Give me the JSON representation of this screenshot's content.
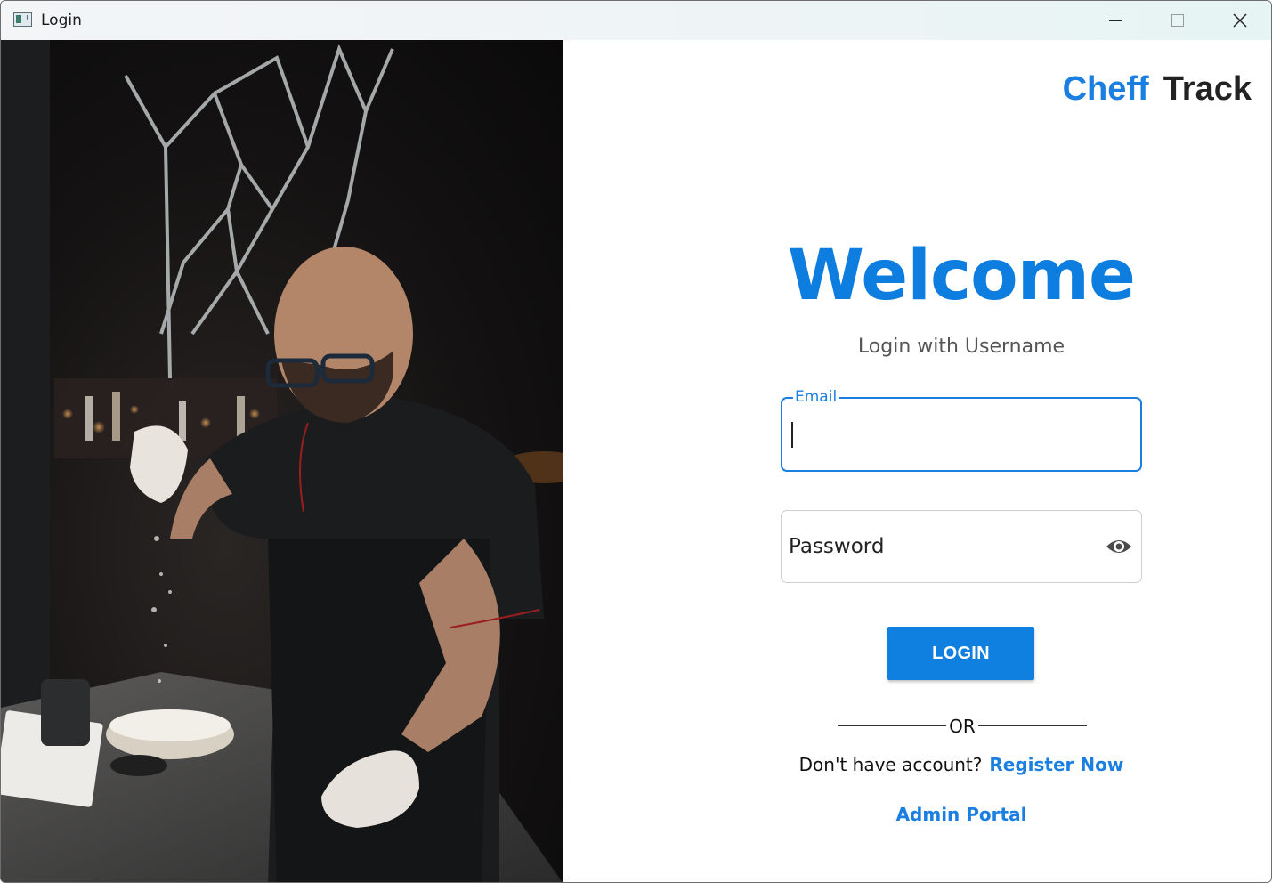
{
  "window": {
    "title": "Login",
    "controls": [
      "minimize",
      "maximize",
      "close"
    ]
  },
  "photo": {
    "icon": "chef-photo"
  },
  "brand": {
    "part1": "Cheff",
    "part2": "Track",
    "accent_color": "#1a7fe0"
  },
  "form": {
    "heading": "Welcome",
    "subtitle": "Login with Username",
    "email": {
      "label": "Email",
      "value": ""
    },
    "password": {
      "placeholder": "Password",
      "value": "",
      "toggle_icon": "eye-icon"
    },
    "login_label": "LOGIN",
    "divider_text": "OR",
    "register_prompt": "Don't have account?",
    "register_link": "Register Now",
    "admin_link": "Admin Portal"
  }
}
